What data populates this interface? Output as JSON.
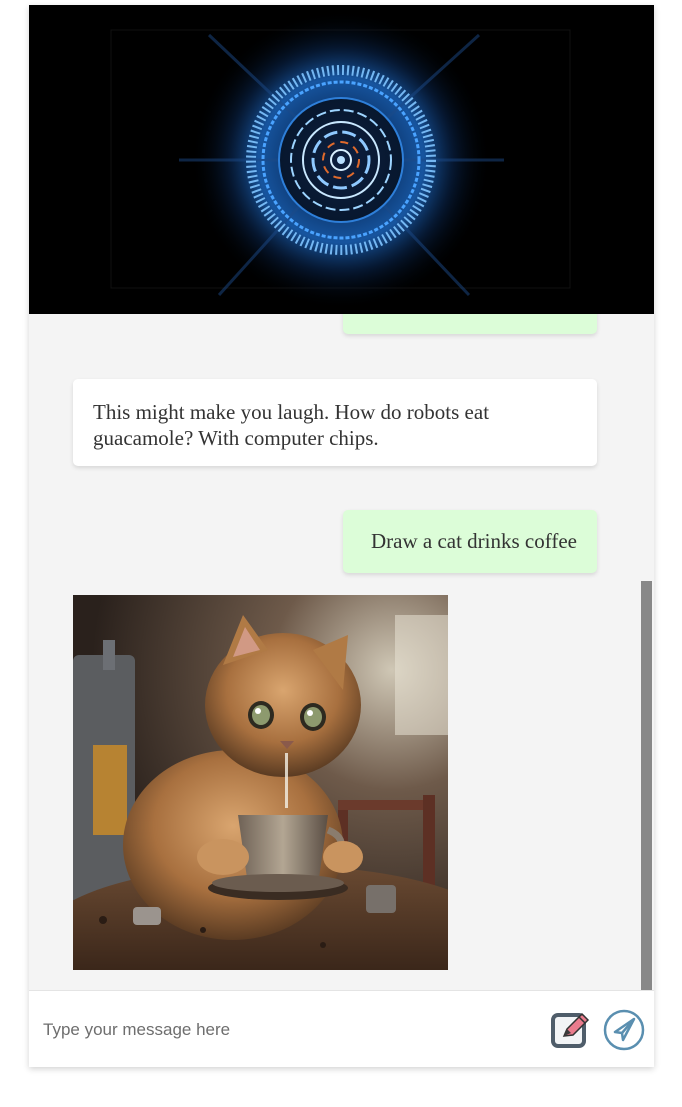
{
  "video": {
    "label": "visualizer-video"
  },
  "messages": [
    {
      "role": "user",
      "text": ""
    },
    {
      "role": "bot",
      "text": "This might make you laugh. How do robots eat guacamole? With computer chips."
    },
    {
      "role": "user",
      "text": "Draw a cat drinks coffee"
    },
    {
      "role": "bot",
      "type": "image",
      "alt": ""
    }
  ],
  "composer": {
    "placeholder": "Type your message here"
  },
  "icons": {
    "edit": "edit-note-icon",
    "send": "paper-plane-icon"
  },
  "colors": {
    "user_bubble": "#dcfdd8",
    "bot_bubble": "#ffffff",
    "chat_bg": "#f4f4f4",
    "icon_accent": "#5a8fb0"
  }
}
